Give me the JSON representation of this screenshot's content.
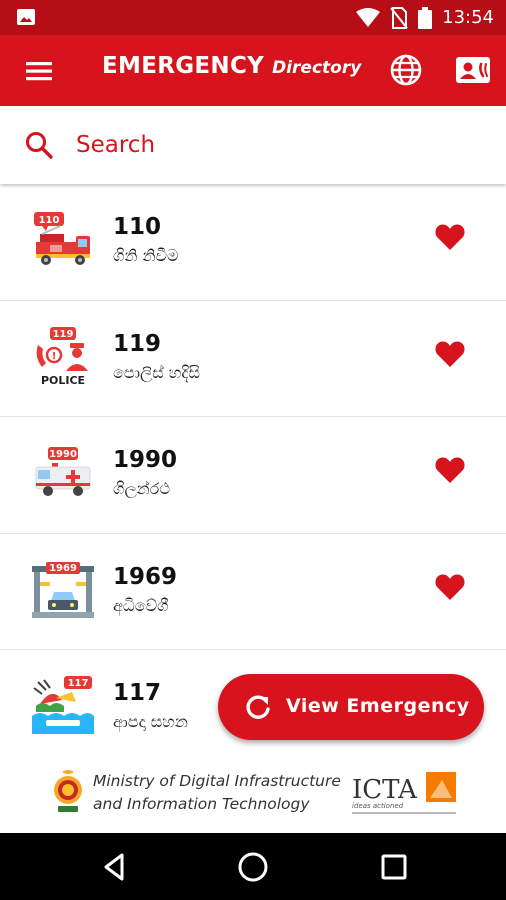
{
  "status_bar": {
    "time": "13:54",
    "icons": [
      "image-icon",
      "wifi-icon",
      "no-sim-icon",
      "battery-icon"
    ]
  },
  "app_bar": {
    "title": "EMERGENCY",
    "subtitle": "Directory",
    "icons": [
      "menu-icon",
      "globe-icon",
      "contact-card-icon"
    ]
  },
  "search": {
    "placeholder": "Search"
  },
  "entries": [
    {
      "number": "110",
      "label": "ගිනි නිවීම",
      "icon": "fire-truck-icon",
      "badge": "110",
      "favorite": true
    },
    {
      "number": "119",
      "label": "පොලිස් හදිසි",
      "icon": "police-icon",
      "badge": "119",
      "badge_caption": "POLICE",
      "favorite": true
    },
    {
      "number": "1990",
      "label": "ගිලන්රථ",
      "icon": "ambulance-icon",
      "badge": "1990",
      "favorite": true
    },
    {
      "number": "1969",
      "label": "අධිවේගී",
      "icon": "expressway-toll-icon",
      "badge": "1969",
      "favorite": true
    },
    {
      "number": "117",
      "label": "ආපදා සහන",
      "icon": "disaster-relief-icon",
      "badge": "117",
      "favorite": false
    }
  ],
  "fab": {
    "label": "View Emergency",
    "icon": "refresh-icon"
  },
  "footer": {
    "ministry_line1": "Ministry of Digital Infrastructure",
    "ministry_line2": "and Information Technology",
    "icta_text": "ICTA",
    "icta_tagline": "ideas actioned"
  },
  "colors": {
    "primary": "#d7141d",
    "status_bar": "#b50e16",
    "favorite": "#d7141d"
  }
}
